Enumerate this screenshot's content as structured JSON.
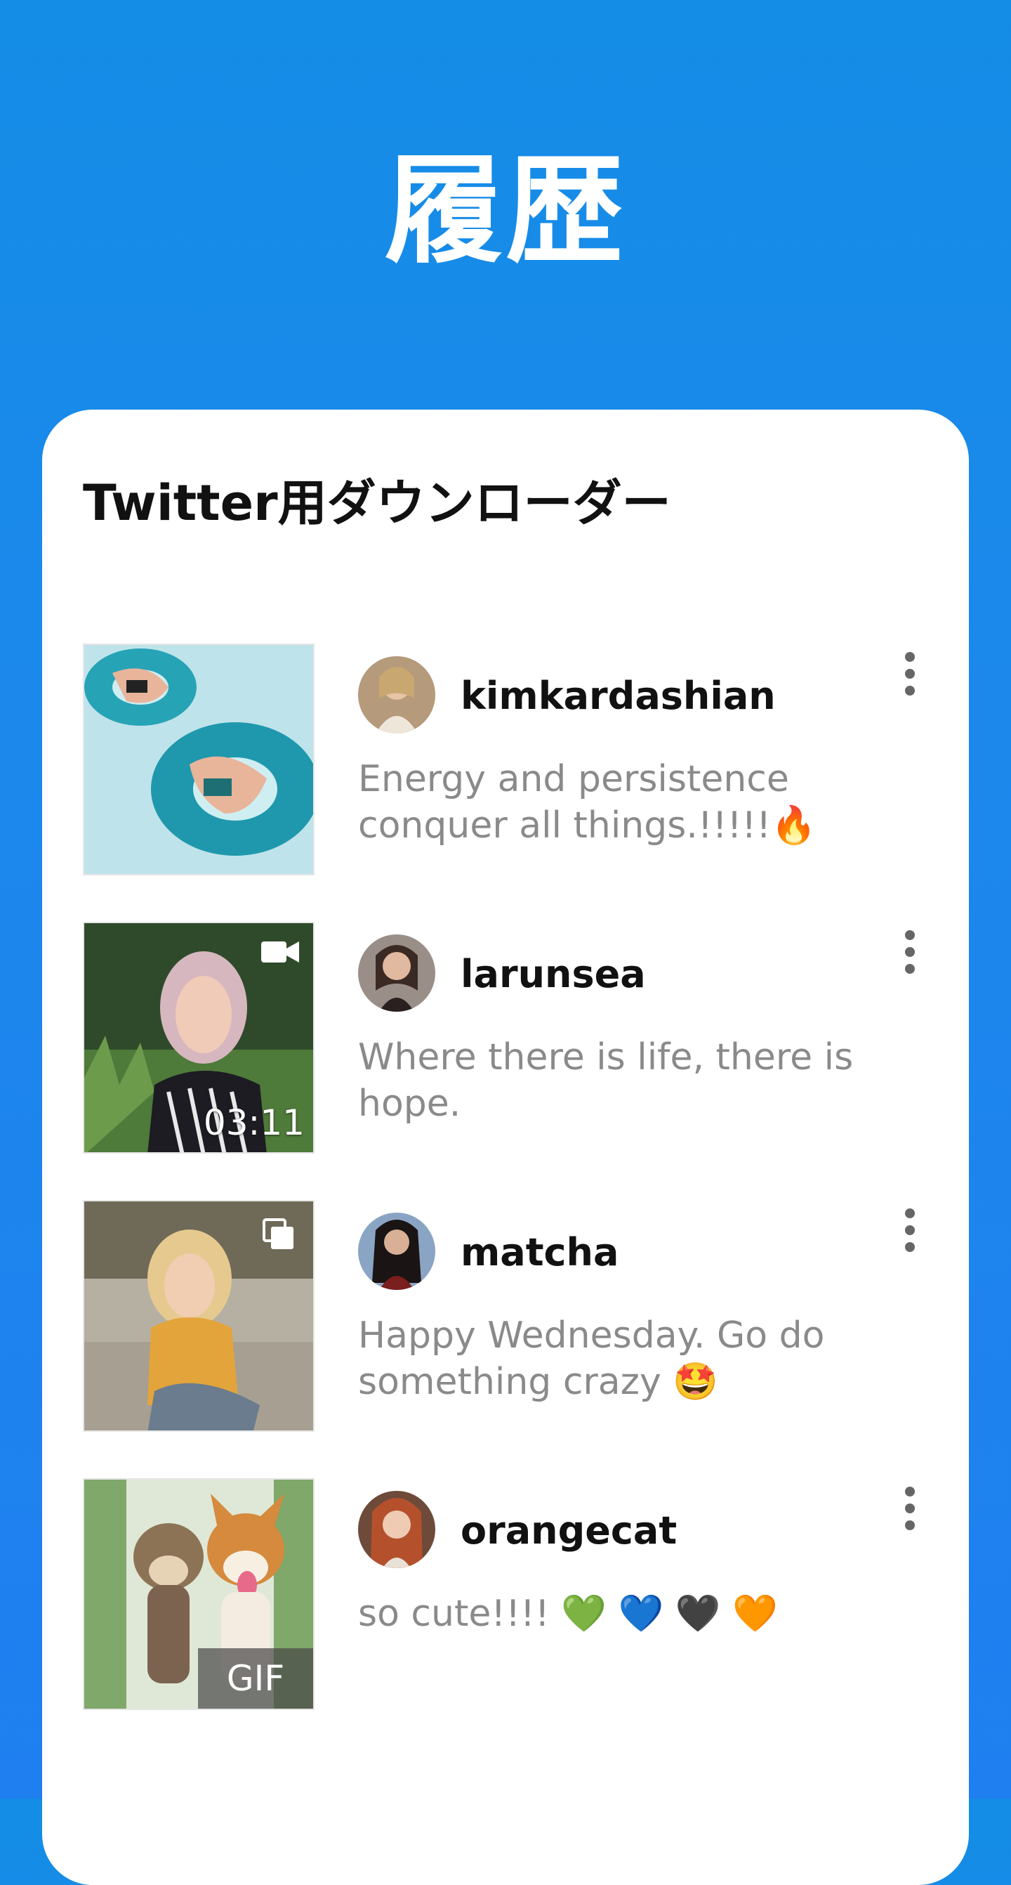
{
  "header": {
    "title": "履歴"
  },
  "card": {
    "title": "Twitter用ダウンローダー"
  },
  "items": [
    {
      "username": "kimkardashian",
      "caption": "Energy and persistence conquer all things.!!!!!🔥",
      "media": "photo",
      "thumb_icon": "none"
    },
    {
      "username": "larunsea",
      "caption": "Where there is life, there is hope.",
      "media": "video",
      "thumb_icon": "video-camera-icon",
      "duration": "03:11"
    },
    {
      "username": "matcha",
      "caption": "Happy Wednesday. Go do something crazy 🤩",
      "media": "multi-photo",
      "thumb_icon": "multiple-images-icon"
    },
    {
      "username": "orangecat",
      "caption": "so cute!!!! 💚 💙 🖤 🧡",
      "media": "gif",
      "gif_label": "GIF"
    }
  ],
  "colors": {
    "background": "#1a88eb",
    "card": "#ffffff",
    "caption": "#8a8a8a",
    "username": "#111111"
  }
}
